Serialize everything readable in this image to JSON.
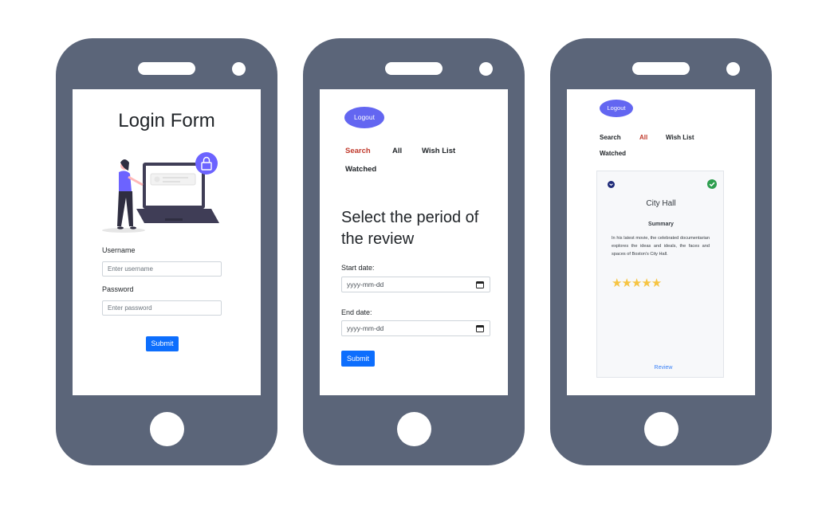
{
  "phone1": {
    "title": "Login Form",
    "username_label": "Username",
    "username_placeholder": "Enter username",
    "password_label": "Password",
    "password_placeholder": "Enter password",
    "submit_label": "Submit"
  },
  "phone2": {
    "logout_label": "Logout",
    "nav": [
      "Search",
      "All",
      "Wish List",
      "Watched"
    ],
    "active_tab": "Search",
    "heading": "Select the period of the review",
    "start_label": "Start date:",
    "start_value": "yyyy-mm-dd",
    "end_label": "End date:",
    "end_value": "yyyy-mm-dd",
    "submit_label": "Submit"
  },
  "phone3": {
    "logout_label": "Logout",
    "nav": [
      "Search",
      "All",
      "Wish List",
      "Watched"
    ],
    "active_tab": "All",
    "card": {
      "title": "City Hall",
      "subtitle": "Summary",
      "description": "In his latest movie, the celebrated documentarian explores the ideas and ideals, the faces and spaces of Boston's City Hall.",
      "rating": 5,
      "stars": "★★★★★",
      "review_link": "Review"
    }
  },
  "colors": {
    "phone_body": "#5b6579",
    "primary": "#0d6efd",
    "logout": "#6366f1",
    "active_nav": "#c0392b",
    "star": "#f6c443",
    "check": "#2e9e4f"
  }
}
